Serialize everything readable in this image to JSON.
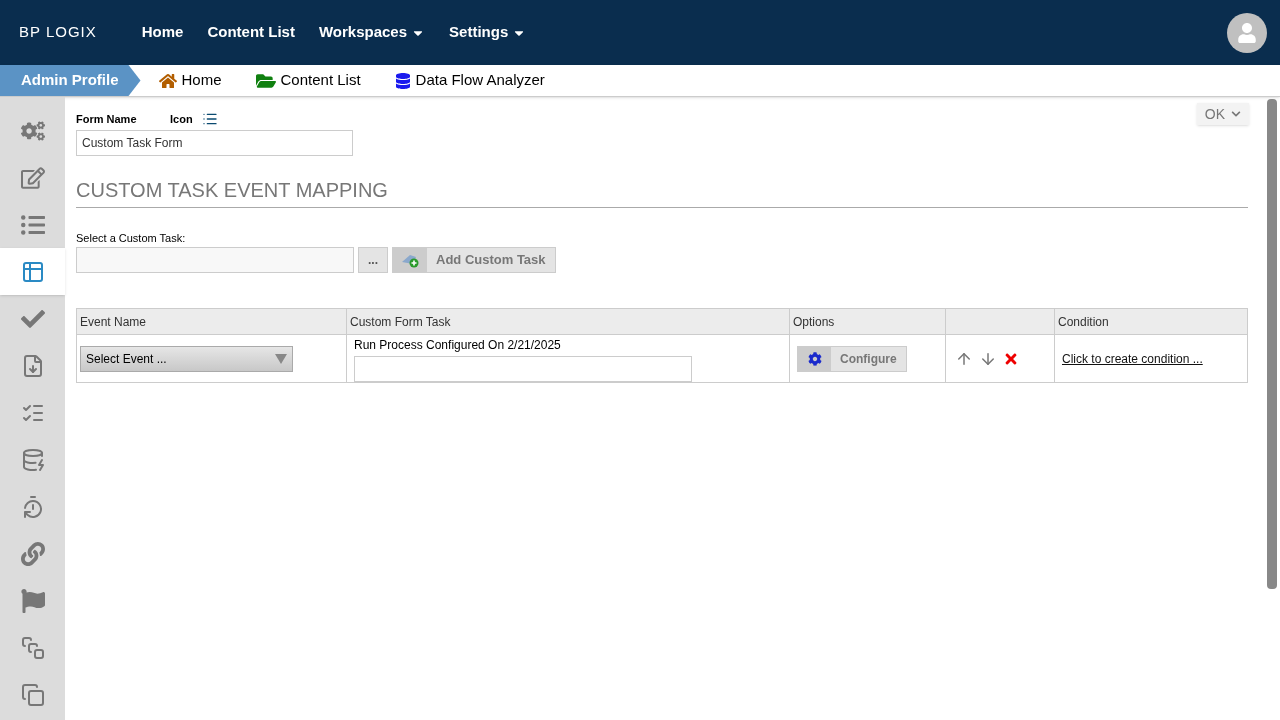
{
  "logo": {
    "text": "BP LOGIX"
  },
  "top_nav": [
    {
      "label": "Home",
      "dropdown": false
    },
    {
      "label": "Content List",
      "dropdown": false
    },
    {
      "label": "Workspaces",
      "dropdown": true
    },
    {
      "label": "Settings",
      "dropdown": true
    }
  ],
  "profile_tab": {
    "label": "Admin Profile"
  },
  "quick_links": [
    {
      "label": "Home",
      "kind": "home"
    },
    {
      "label": "Content List",
      "kind": "folder"
    },
    {
      "label": "Data Flow Analyzer",
      "kind": "database"
    }
  ],
  "sidebar": [
    {
      "kind": "settings",
      "selected": false
    },
    {
      "kind": "edit",
      "selected": false
    },
    {
      "kind": "list",
      "selected": false
    },
    {
      "kind": "table",
      "selected": true
    },
    {
      "kind": "check",
      "selected": false
    },
    {
      "kind": "import",
      "selected": false
    },
    {
      "kind": "form",
      "selected": false
    },
    {
      "kind": "database-add",
      "selected": false
    },
    {
      "kind": "clock",
      "selected": false
    },
    {
      "kind": "link",
      "selected": false
    },
    {
      "kind": "flag",
      "selected": false
    },
    {
      "kind": "shapes",
      "selected": false
    },
    {
      "kind": "copy",
      "selected": false
    }
  ],
  "ok_button": {
    "label": "OK"
  },
  "form_name": {
    "label": "Form Name",
    "value": "Custom Task Form"
  },
  "icon_label": "Icon",
  "section_title": "CUSTOM TASK EVENT MAPPING",
  "custom_task": {
    "label": "Select a Custom Task:",
    "browse": "...",
    "add_button": "Add Custom Task"
  },
  "table": {
    "columns": [
      "Event Name",
      "Custom Form Task",
      "Options",
      "",
      "Condition"
    ],
    "rows": [
      {
        "event": "Select Event ...",
        "task_text": "Run Process Configured On 2/21/2025",
        "configure": "Configure",
        "condition": "Click to create condition ..."
      }
    ]
  }
}
